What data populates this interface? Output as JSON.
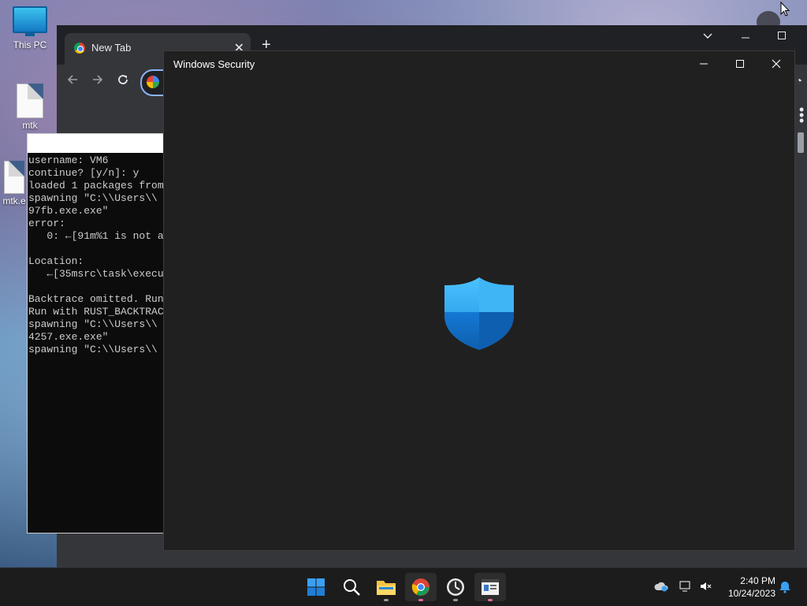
{
  "desktop": {
    "icons": [
      {
        "label": "This PC"
      },
      {
        "label": "mtk"
      },
      {
        "label": "mtk.e"
      }
    ]
  },
  "chrome": {
    "tab_title": "New Tab"
  },
  "terminal": {
    "lines": [
      "username: VM6",
      "continue? [y/n]: y",
      "loaded 1 packages from",
      "spawning \"C:\\\\Users\\\\",
      "97fb.exe.exe\"",
      "error:",
      "   0: ←[91m%1 is not a",
      "",
      "Location:",
      "   ←[35msrc\\task\\execu",
      "",
      "Backtrace omitted. Run",
      "Run with RUST_BACKTRAC",
      "spawning \"C:\\\\Users\\\\",
      "4257.exe.exe\"",
      "spawning \"C:\\\\Users\\\\"
    ]
  },
  "security": {
    "title": "Windows Security"
  },
  "taskbar": {
    "apps": [
      "start-icon",
      "search-icon",
      "file-explorer-icon",
      "chrome-icon",
      "clock-app-icon",
      "terminal-app-icon"
    ]
  },
  "clock": {
    "time": "2:40 PM",
    "date": "10/24/2023"
  },
  "colors": {
    "accent": "#0078d4",
    "shield_light": "#4cc2ff",
    "shield_dark": "#0f6cbd"
  }
}
